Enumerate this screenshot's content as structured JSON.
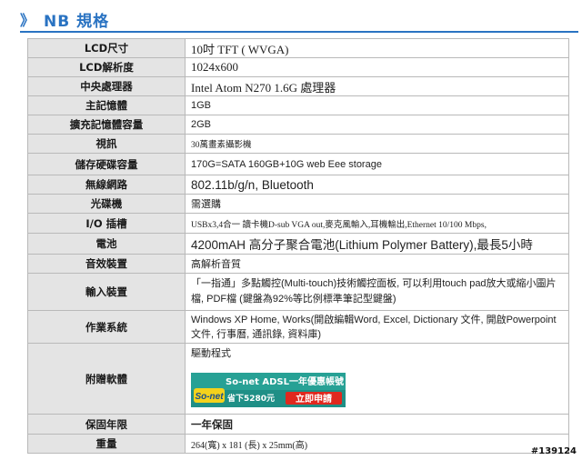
{
  "header": {
    "chevron": "》",
    "title": "NB 規格"
  },
  "specs": {
    "lcd_size": {
      "label": "LCD尺寸",
      "value": "10吋 TFT ( WVGA)"
    },
    "lcd_resolution": {
      "label": "LCD解析度",
      "value": "1024x600"
    },
    "cpu": {
      "label": "中央處理器",
      "value": "Intel Atom N270 1.6G 處理器"
    },
    "main_memory": {
      "label": "主記憶體",
      "value": "1GB"
    },
    "expand_memory": {
      "label": "擴充記憶體容量",
      "value": "2GB"
    },
    "video": {
      "label": "視訊",
      "value": "30萬畫素攝影機"
    },
    "storage": {
      "label": "儲存硬碟容量",
      "value": "170G=SATA 160GB+10G web Eee storage"
    },
    "wireless": {
      "label": "無線網路",
      "value": "802.11b/g/n, Bluetooth"
    },
    "optical": {
      "label": "光碟機",
      "value": "需選購"
    },
    "io": {
      "label": "I/O 插槽",
      "value": "USBx3,4合一 讀卡機D-sub VGA out,麥克風輸入,耳機輸出,Ethernet 10/100 Mbps,"
    },
    "battery": {
      "label": "電池",
      "value": "4200mAH 高分子聚合電池(Lithium Polymer Battery),最長5小時"
    },
    "audio": {
      "label": "音效裝置",
      "value": "高解析音質"
    },
    "input": {
      "label": "輸入裝置",
      "value": "「一指通」多點觸控(Multi-touch)技術觸控面板, 可以利用touch pad放大或縮小圖片檔, PDF檔 (鍵盤為92%等比例標準筆記型鍵盤)"
    },
    "os": {
      "label": "作業系統",
      "value": "Windows XP Home, Works(開啟編輯Word, Excel, Dictionary 文件, 開啟Powerpoint 文件, 行事曆, 通訊錄, 資料庫)"
    },
    "software": {
      "label": "附贈軟體",
      "value": "驅動程式"
    },
    "warranty": {
      "label": "保固年限",
      "value": "一年保固"
    },
    "weight": {
      "label": "重量",
      "value": "264(寬) x 181 (長) x 25mm(高)"
    }
  },
  "ad": {
    "brand": "So-net",
    "headline": "So-net ADSL一年優惠帳號",
    "save_text": "省下5280元",
    "cta": "立即申請",
    "colors": {
      "bg": "#1f8f86",
      "accent": "#f3d21c",
      "cta": "#e0281e"
    }
  },
  "watermark": "#139124"
}
